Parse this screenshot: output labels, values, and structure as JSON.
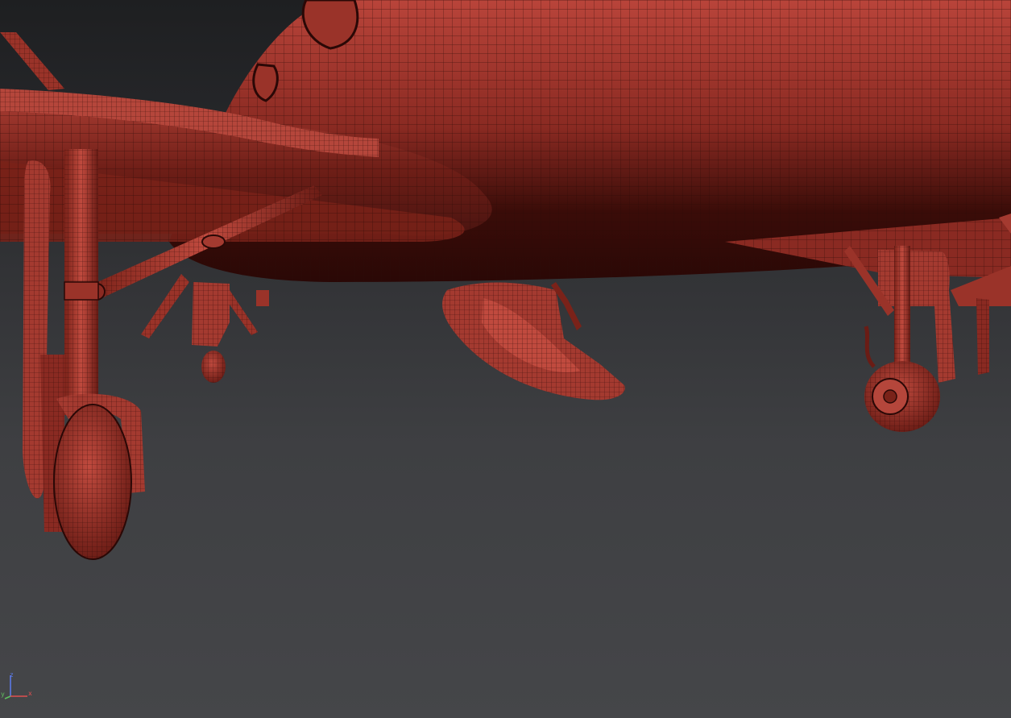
{
  "viewport": {
    "background_top": "#1e1f21",
    "background_bottom": "#454649",
    "mesh_color": "#a8382c",
    "wire_color": "#2a0a07",
    "shadow_color": "#3a0c08"
  },
  "axis_gizmo": {
    "x_label": "x",
    "y_label": "y",
    "z_label": "z",
    "x_color": "#e05050",
    "y_color": "#60c060",
    "z_color": "#5d7df0"
  }
}
